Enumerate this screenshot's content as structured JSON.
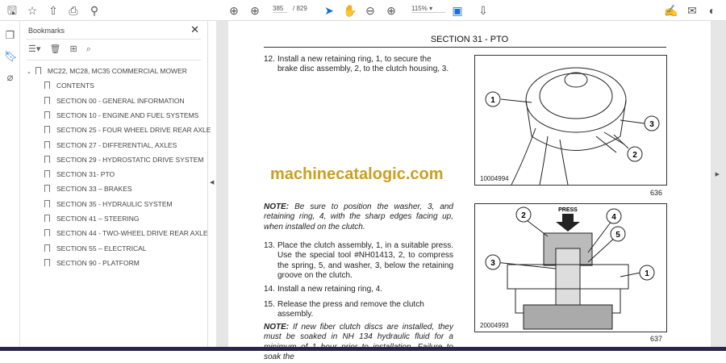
{
  "toolbar": {
    "page_current": "385",
    "page_total": "/ 829",
    "zoom": "115%"
  },
  "bookmarks": {
    "title": "Bookmarks",
    "items": [
      "MC22, MC28, MC35 COMMERCIAL MOWER",
      "CONTENTS",
      "SECTION 00 - GENERAL INFORMATION",
      "SECTION 10 - ENGINE AND FUEL SYSTEMS",
      "SECTION 25 - FOUR WHEEL DRIVE REAR AXLE",
      "SECTION 27 - DIFFERENTIAL, AXLES",
      "SECTION 29 - HYDROSTATIC DRIVE SYSTEM",
      "SECTION 31- PTO",
      "SECTION 33 – BRAKES",
      "SECTION 35 - HYDRAULIC SYSTEM",
      "SECTION 41 – STEERING",
      "SECTION 44 - TWO-WHEEL DRIVE REAR AXLE",
      "SECTION 55 – ELECTRICAL",
      "SECTION 90 - PLATFORM"
    ]
  },
  "doc": {
    "section": "SECTION 31 - PTO",
    "step12_num": "12.",
    "step12": "Install a new retaining ring, 1, to secure the brake disc assembly, 2, to the clutch housing, 3.",
    "watermark": "machinecatalogic.com",
    "note1_label": "NOTE:",
    "note1": " Be sure to position the washer, 3, and retaining ring, 4, with the sharp edges facing up, when installed on the clutch.",
    "step13_num": "13.",
    "step13": "Place the clutch assembly, 1, in a suitable press. Use the special tool #NH01413, 2, to compress the spring, 5, and washer, 3, below the retaining groove on the clutch.",
    "step14_num": "14.",
    "step14": "Install a new retaining ring, 4.",
    "step15_num": "15.",
    "step15": "Release the press and remove the clutch assembly.",
    "note2_label": "NOTE:",
    "note2": " If new fiber clutch discs are installed, they must be soaked in NH 134 hydraulic fluid for a minimum of 1 hour prior to installation. Failure to soak the",
    "fig1": {
      "code": "10004994",
      "number": "636",
      "callouts": [
        "1",
        "2",
        "3"
      ]
    },
    "fig2": {
      "code": "20004993",
      "number": "637",
      "press": "PRESS",
      "callouts": [
        "1",
        "2",
        "3",
        "4",
        "5"
      ]
    }
  }
}
